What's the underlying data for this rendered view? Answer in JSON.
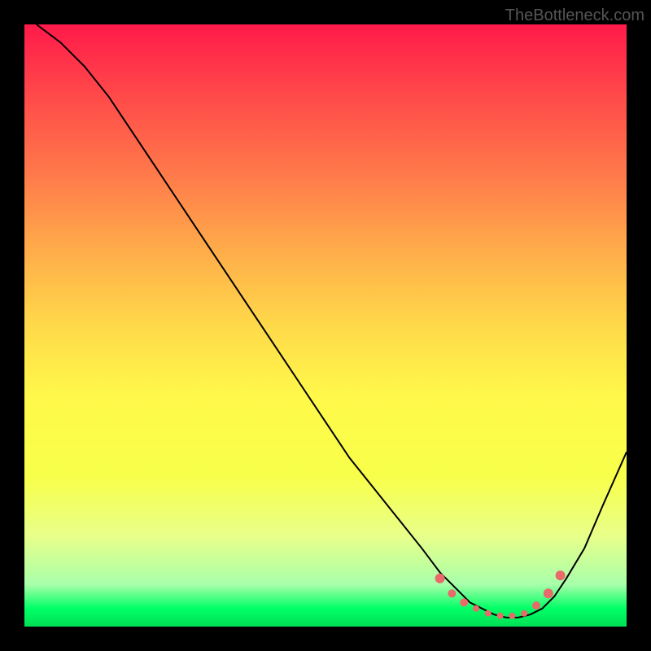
{
  "watermark": "TheBottleneck.com",
  "chart_data": {
    "type": "line",
    "title": "",
    "xlabel": "",
    "ylabel": "",
    "xlim": [
      0,
      100
    ],
    "ylim": [
      0,
      100
    ],
    "series": [
      {
        "name": "bottleneck-curve",
        "x": [
          2,
          6,
          10,
          14,
          18,
          22,
          26,
          30,
          34,
          38,
          42,
          46,
          50,
          54,
          58,
          62,
          66,
          69,
          72,
          74,
          76,
          78,
          80,
          82,
          84,
          86,
          88,
          90,
          93,
          96,
          100
        ],
        "values": [
          100,
          97,
          93,
          88,
          82,
          76,
          70,
          64,
          58,
          52,
          46,
          40,
          34,
          28,
          23,
          18,
          13,
          9,
          6,
          4,
          3,
          2,
          1.5,
          1.5,
          2,
          3,
          5,
          8,
          13,
          20,
          29
        ]
      }
    ],
    "markers": {
      "name": "bottom-dots",
      "x": [
        69,
        71,
        73,
        75,
        77,
        79,
        81,
        83,
        85,
        87,
        89
      ],
      "values": [
        8,
        5.5,
        4,
        3,
        2.2,
        1.8,
        1.8,
        2.2,
        3.5,
        5.5,
        8.5
      ],
      "sizes": [
        6,
        5,
        5,
        4,
        4,
        4,
        4,
        4,
        5,
        6,
        6
      ]
    }
  }
}
